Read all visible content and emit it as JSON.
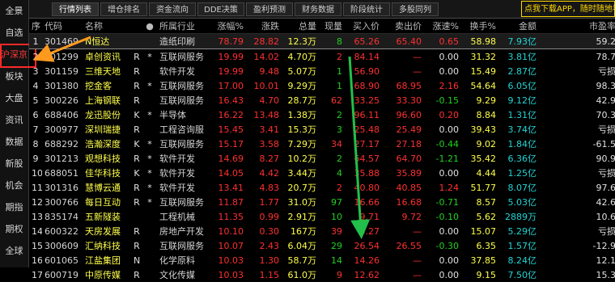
{
  "sidebar": {
    "items": [
      "全景",
      "自选",
      "沪深京",
      "板块",
      "大盘",
      "资讯",
      "数据",
      "新股",
      "机会",
      "期指",
      "期权",
      "全球"
    ],
    "active_index": 2
  },
  "tabs": [
    "行情列表",
    "增仓排名",
    "资金流向",
    "DDE决策",
    "盈利预测",
    "财务数据",
    "阶段统计",
    "多股同列"
  ],
  "promo": "点我下载APP，随时随地看",
  "columns": [
    "序",
    "代码",
    "名称",
    "",
    "●",
    "所属行业",
    "涨幅%",
    "涨跌",
    "总量",
    "现量",
    "买入价",
    "卖出价",
    "涨速%",
    "换手%",
    "金额",
    "市盈率"
  ],
  "rows": [
    {
      "no": "1",
      "code": "301469",
      "name": "N恒达",
      "mark": "",
      "star": "",
      "industry": "造纸印刷",
      "pct": "78.79",
      "chg": "28.82",
      "vol": "12.3万",
      "cur": "8",
      "buy": "65.26",
      "sell": "65.40",
      "speed": "0.65",
      "turn": "58.98",
      "amt": "7.93亿",
      "pe": "59.2"
    },
    {
      "no": "2",
      "code": "301299",
      "name": "卓创资讯",
      "mark": "R",
      "star": "*",
      "industry": "互联网服务",
      "pct": "19.99",
      "chg": "14.02",
      "vol": "4.70万",
      "cur": "2",
      "buy": "84.14",
      "sell": "—",
      "speed": "0.00",
      "turn": "31.32",
      "amt": "3.81亿",
      "pe": "78.7"
    },
    {
      "no": "3",
      "code": "301159",
      "name": "三维天地",
      "mark": "R",
      "star": "",
      "industry": "软件开发",
      "pct": "19.99",
      "chg": "9.48",
      "vol": "5.07万",
      "cur": "1",
      "buy": "56.90",
      "sell": "—",
      "speed": "0.00",
      "turn": "15.49",
      "amt": "2.87亿",
      "pe": "亏损"
    },
    {
      "no": "4",
      "code": "301380",
      "name": "挖金客",
      "mark": "R",
      "star": "*",
      "industry": "互联网服务",
      "pct": "17.00",
      "chg": "10.01",
      "vol": "9.29万",
      "cur": "1",
      "buy": "68.90",
      "sell": "68.95",
      "speed": "2.16",
      "turn": "54.64",
      "amt": "6.05亿",
      "pe": "98.3"
    },
    {
      "no": "5",
      "code": "300226",
      "name": "上海钢联",
      "mark": "R",
      "star": "",
      "industry": "互联网服务",
      "pct": "16.43",
      "chg": "4.70",
      "vol": "28.7万",
      "cur": "62",
      "buy": "33.25",
      "sell": "33.30",
      "speed": "-0.15",
      "turn": "9.29",
      "amt": "9.12亿",
      "pe": "42.9"
    },
    {
      "no": "6",
      "code": "688406",
      "name": "龙迅股份",
      "mark": "K",
      "star": "*",
      "industry": "半导体",
      "pct": "16.22",
      "chg": "13.48",
      "vol": "1.38万",
      "cur": "2",
      "buy": "96.11",
      "sell": "96.60",
      "speed": "0.20",
      "turn": "8.84",
      "amt": "1.31亿",
      "pe": "70.3"
    },
    {
      "no": "7",
      "code": "300977",
      "name": "深圳瑞捷",
      "mark": "R",
      "star": "",
      "industry": "工程咨询服",
      "pct": "15.45",
      "chg": "3.41",
      "vol": "15.3万",
      "cur": "3",
      "buy": "25.48",
      "sell": "25.49",
      "speed": "0.00",
      "turn": "39.43",
      "amt": "3.74亿",
      "pe": "亏损"
    },
    {
      "no": "8",
      "code": "688292",
      "name": "浩瀚深度",
      "mark": "K",
      "star": "*",
      "industry": "互联网服务",
      "pct": "15.17",
      "chg": "3.58",
      "vol": "7.29万",
      "cur": "34",
      "buy": "27.17",
      "sell": "27.18",
      "speed": "-0.44",
      "turn": "9.02",
      "amt": "1.84亿",
      "pe": "-61.5"
    },
    {
      "no": "9",
      "code": "301213",
      "name": "观想科技",
      "mark": "R",
      "star": "*",
      "industry": "软件开发",
      "pct": "14.69",
      "chg": "8.27",
      "vol": "10.2万",
      "cur": "2",
      "buy": "64.57",
      "sell": "64.70",
      "speed": "-1.21",
      "turn": "35.42",
      "amt": "6.36亿",
      "pe": "90.9"
    },
    {
      "no": "10",
      "code": "688051",
      "name": "佳华科技",
      "mark": "K",
      "star": "*",
      "industry": "软件开发",
      "pct": "14.05",
      "chg": "4.42",
      "vol": "3.44万",
      "cur": "4",
      "buy": "35.88",
      "sell": "35.89",
      "speed": "0.00",
      "turn": "4.44",
      "amt": "1.25亿",
      "pe": "亏损"
    },
    {
      "no": "11",
      "code": "301316",
      "name": "慧博云通",
      "mark": "R",
      "star": "*",
      "industry": "软件开发",
      "pct": "13.41",
      "chg": "4.83",
      "vol": "20.7万",
      "cur": "2",
      "buy": "40.80",
      "sell": "40.85",
      "speed": "1.24",
      "turn": "51.77",
      "amt": "8.07亿",
      "pe": "97.6"
    },
    {
      "no": "12",
      "code": "300766",
      "name": "每日互动",
      "mark": "R",
      "star": "*",
      "industry": "互联网服务",
      "pct": "11.87",
      "chg": "1.77",
      "vol": "31.0万",
      "cur": "97",
      "buy": "16.66",
      "sell": "16.68",
      "speed": "-0.71",
      "turn": "8.57",
      "amt": "5.03亿",
      "pe": "42.6"
    },
    {
      "no": "13",
      "code": "835174",
      "name": "五新隧装",
      "mark": "",
      "star": "",
      "industry": "工程机械",
      "pct": "11.35",
      "chg": "0.99",
      "vol": "2.91万",
      "cur": "10",
      "buy": "9.71",
      "sell": "9.72",
      "speed": "-0.10",
      "turn": "5.62",
      "amt": "2889万",
      "pe": "10.6"
    },
    {
      "no": "14",
      "code": "600322",
      "name": "天房发展",
      "mark": "R",
      "star": "",
      "industry": "房地产开发",
      "pct": "10.10",
      "chg": "0.30",
      "vol": "167万",
      "cur": "39",
      "buy": "3.27",
      "sell": "—",
      "speed": "0.00",
      "turn": "15.07",
      "amt": "5.29亿",
      "pe": "亏损"
    },
    {
      "no": "15",
      "code": "300609",
      "name": "汇纳科技",
      "mark": "R",
      "star": "",
      "industry": "互联网服务",
      "pct": "10.07",
      "chg": "2.43",
      "vol": "6.04万",
      "cur": "29",
      "buy": "26.54",
      "sell": "26.55",
      "speed": "-0.30",
      "turn": "6.35",
      "amt": "1.57亿",
      "pe": "-12.9"
    },
    {
      "no": "16",
      "code": "601065",
      "name": "江盐集团",
      "mark": "N",
      "star": "",
      "industry": "化学原料",
      "pct": "10.03",
      "chg": "1.30",
      "vol": "58.7万",
      "cur": "14",
      "buy": "14.26",
      "sell": "—",
      "speed": "0.00",
      "turn": "37.85",
      "amt": "8.24亿",
      "pe": "12.1"
    },
    {
      "no": "17",
      "code": "600719",
      "name": "中原传媒",
      "mark": "R",
      "star": "",
      "industry": "文化传媒",
      "pct": "10.03",
      "chg": "1.15",
      "vol": "61.0万",
      "cur": "9",
      "buy": "12.62",
      "sell": "—",
      "speed": "0.00",
      "turn": "9.15",
      "amt": "7.50亿",
      "pe": "15.3"
    }
  ],
  "colors": {
    "up": "#ff3030",
    "down": "#20d020",
    "name": "#ffff4c",
    "amount": "#23d5d5",
    "highlight": "#ff2a2a",
    "arrow": "#22c04a"
  }
}
